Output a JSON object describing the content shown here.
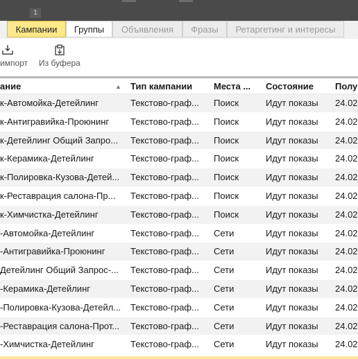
{
  "topbar": {
    "badge": "1"
  },
  "tabs": [
    {
      "label": "Кампании",
      "active": true
    },
    {
      "label": "Группы",
      "active": false
    },
    {
      "label": "Объявления",
      "active": false
    },
    {
      "label": "Фразы",
      "active": false
    },
    {
      "label": "Ретаргетинг и интересы",
      "active": false
    }
  ],
  "toolbar": {
    "import_label": "импорт",
    "buffer_label": "Из буфера"
  },
  "table": {
    "columns": [
      "ание",
      "Тип кампании",
      "Места ...",
      "Состояние",
      "Полу"
    ],
    "rows": [
      [
        "к-Автомойка-Детейлинг",
        "Текстово-граф...",
        "Поиск",
        "Идут показы",
        "24.02"
      ],
      [
        "к-Антигравийка-Проюнинг",
        "Текстово-граф...",
        "Поиск",
        "Идут показы",
        "24.02"
      ],
      [
        "к-Детейлинг Общий Запро...",
        "Текстово-граф...",
        "Поиск",
        "Идут показы",
        "24.02"
      ],
      [
        "к-Керамика-Детейлинг",
        "Текстово-граф...",
        "Поиск",
        "Идут показы",
        "24.02"
      ],
      [
        "к-Полировка-Кузова-Детей...",
        "Текстово-граф...",
        "Поиск",
        "Идут показы",
        "24.02"
      ],
      [
        "к-Реставрация салона-Пр...",
        "Текстово-граф...",
        "Поиск",
        "Идут показы",
        "24.02"
      ],
      [
        "к-Химчистка-Детейлинг",
        "Текстово-граф...",
        "Поиск",
        "Идут показы",
        "24.02"
      ],
      [
        "-Автомойка-Детейлинг",
        "Текстово-граф...",
        "Сети",
        "Идут показы",
        "24.02"
      ],
      [
        "-Антигравийка-Проюнинг",
        "Текстово-граф...",
        "Сети",
        "Идут показы",
        "24.02"
      ],
      [
        "Детейлинг Общий Запрос-...",
        "Текстово-граф...",
        "Сети",
        "Идут показы",
        "24.02"
      ],
      [
        "-Керамика-Детейлинг",
        "Текстово-граф...",
        "Сети",
        "Идут показы",
        "24.02"
      ],
      [
        "-Полировка-Кузова-Детейл...",
        "Текстово-граф...",
        "Сети",
        "Идут показы",
        "24.02"
      ],
      [
        "-Реставрация салона-Прот...",
        "Текстово-граф...",
        "Сети",
        "Идут показы",
        "24.02"
      ],
      [
        "-Химчистка-Детейлинг",
        "Текстово-граф...",
        "Сети",
        "Идут показы",
        "24.02"
      ]
    ]
  },
  "colors": {
    "active_tab": "#fde88a",
    "row_stripe": "#f2f2f2",
    "topbar": "#4a4a4a"
  },
  "icons": {
    "import": "import-icon",
    "paste": "paste-from-buffer-icon",
    "sort": "sort-ascending-icon"
  }
}
